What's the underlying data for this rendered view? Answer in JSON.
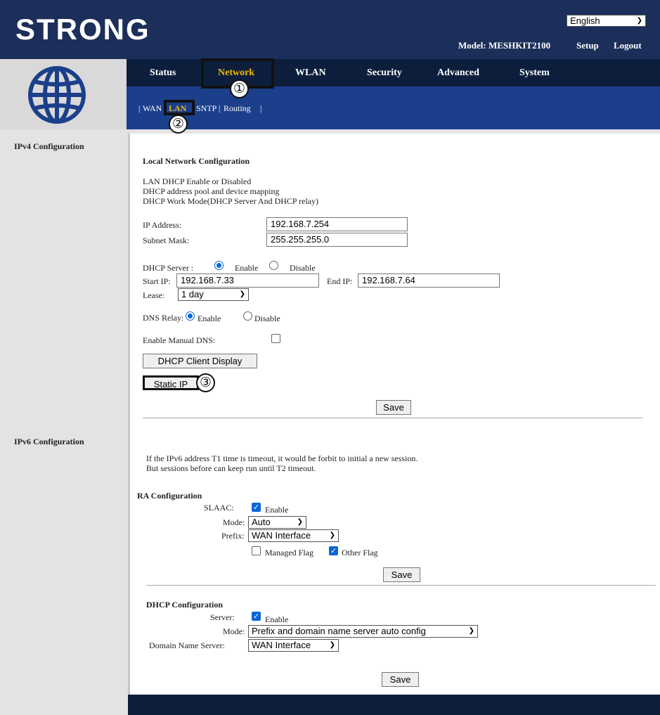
{
  "header": {
    "logo": "STRONG",
    "language": "English",
    "model": "Model: MESHKIT2100",
    "setup": "Setup",
    "logout": "Logout"
  },
  "nav": {
    "status": "Status",
    "network": "Network",
    "wlan": "WLAN",
    "security": "Security",
    "advanced": "Advanced",
    "system": "System"
  },
  "subnav": {
    "sep": "|",
    "wan": "WAN",
    "lan": "LAN",
    "sntp": "SNTP",
    "routing": "Routing"
  },
  "callouts": {
    "one": "①",
    "two": "②",
    "three": "③"
  },
  "sidebar": {
    "ipv4": "IPv4 Configuration",
    "ipv6": "IPv6 Configuration"
  },
  "ipv4": {
    "title": "Local Network Configuration",
    "desc1": "LAN DHCP Enable or Disabled",
    "desc2": "DHCP address pool and device mapping",
    "desc3": "DHCP Work Mode(DHCP Server And DHCP relay)",
    "ip_label": "IP Address:",
    "ip_value": "192.168.7.254",
    "mask_label": "Subnet Mask:",
    "mask_value": "255.255.255.0",
    "dhcp_label": "DHCP Server :",
    "enable": "Enable",
    "disable": "Disable",
    "start_label": "Start IP:",
    "start_value": "192.168.7.33",
    "end_label": "End IP:",
    "end_value": "192.168.7.64",
    "lease_label": "Lease:",
    "lease_value": "1 day",
    "dns_relay_label": "DNS Relay:",
    "manual_dns_label": "Enable Manual DNS:",
    "client_btn": "DHCP Client Display",
    "static_btn": "Static IP",
    "save": "Save"
  },
  "ipv6": {
    "note1": "If the IPv6 address T1 time is timeout, it would be forbit to initial a new session.",
    "note2": "But sessions before can keep run until T2 timeout.",
    "ra_title": "RA Configuration",
    "slaac_label": "SLAAC:",
    "enable": "Enable",
    "mode_label": "Mode:",
    "mode_value": "Auto",
    "prefix_label": "Prefix:",
    "prefix_value": "WAN Interface",
    "managed_flag": "Managed Flag",
    "other_flag": "Other Flag",
    "save": "Save",
    "dhcp_title": "DHCP Configuration",
    "server_label": "Server:",
    "dhcp_mode_label": "Mode:",
    "dhcp_mode_value": "Prefix and domain name server auto config",
    "dns_label": "Domain Name Server:",
    "dns_value": "WAN Interface",
    "save2": "Save"
  }
}
